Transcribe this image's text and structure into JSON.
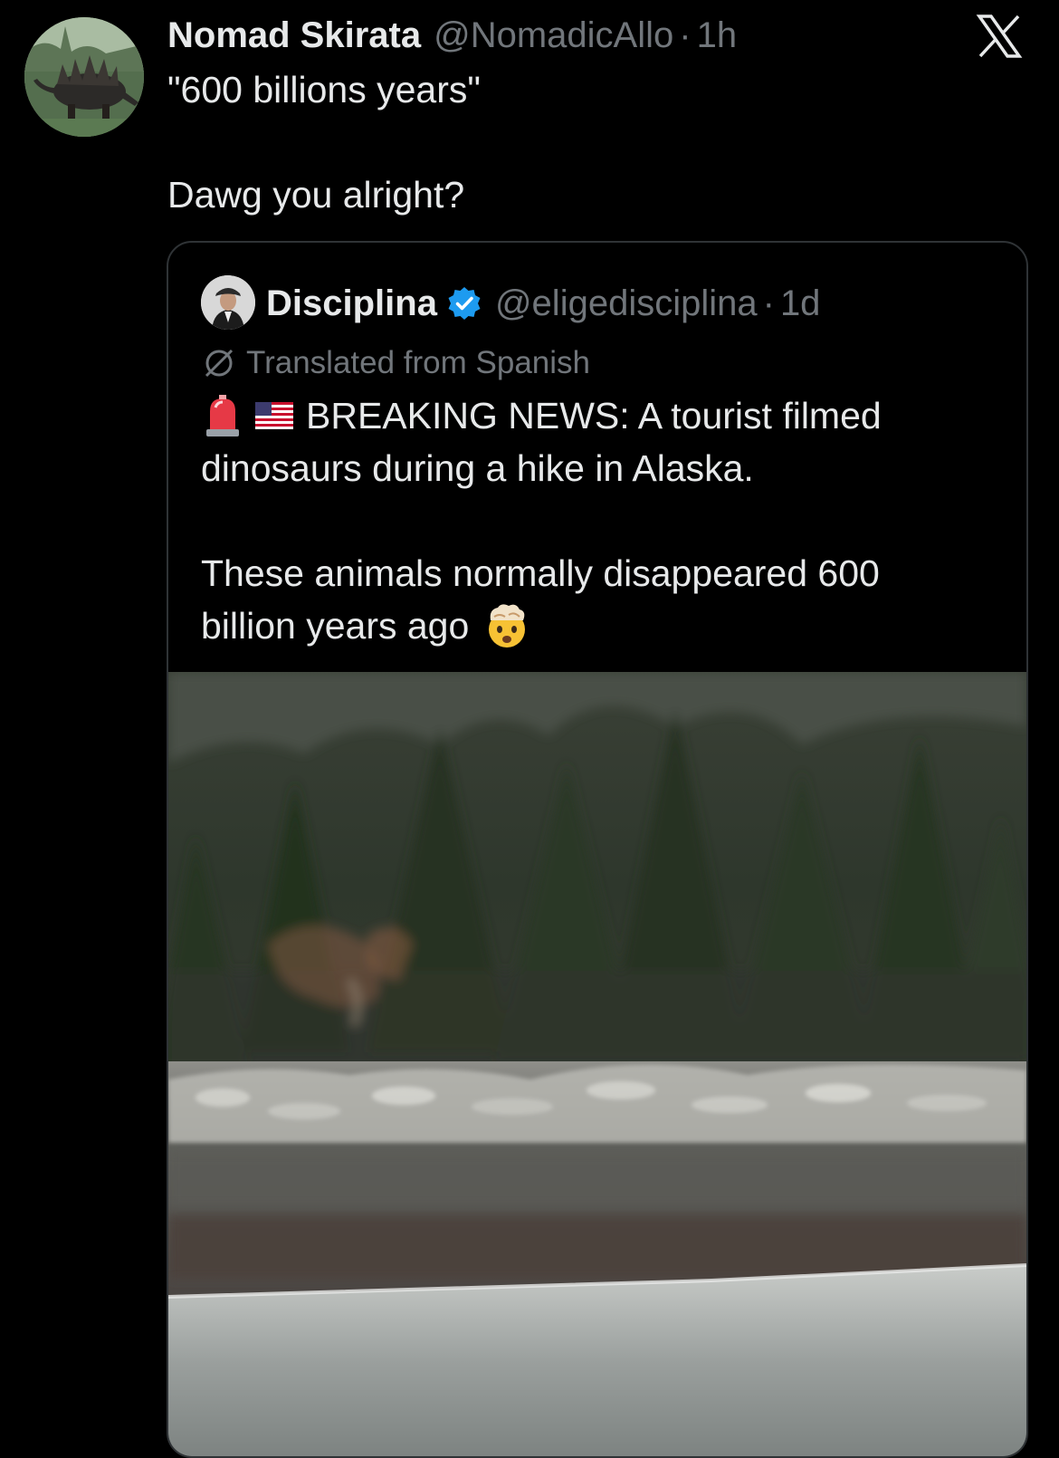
{
  "tweet": {
    "author": {
      "display_name": "Nomad Skirata",
      "handle": "@NomadicAllo",
      "avatar_icon": "stegosaurus-avatar"
    },
    "separator": "·",
    "time": "1h",
    "text_lines": [
      "\"600 billions years\"",
      "",
      "Dawg you alright?"
    ]
  },
  "app": {
    "logo_icon": "x-logo-icon"
  },
  "quoted_tweet": {
    "author": {
      "display_name": "Disciplina",
      "verified": true,
      "handle": "@eligedisciplina",
      "avatar_icon": "man-in-cap-avatar"
    },
    "separator": "·",
    "time": "1d",
    "translated_label": "Translated from Spanish",
    "text": {
      "line1": "BREAKING NEWS: A tourist filmed",
      "line2": "dinosaurs during a hike in Alaska.",
      "line3": "These animals normally disappeared 600",
      "line4": "billion years ago"
    },
    "emojis": {
      "leading": [
        "siren-icon",
        "us-flag-icon"
      ],
      "trailing": "mind-blown-icon"
    },
    "media": {
      "type": "video-still",
      "description_icon": "forest-shoreline-video-thumbnail"
    }
  },
  "colors": {
    "background": "#000000",
    "primary_text": "#e7e9ea",
    "secondary_text": "#71767b",
    "border": "#2f3336",
    "verified_blue": "#1d9bf0"
  }
}
